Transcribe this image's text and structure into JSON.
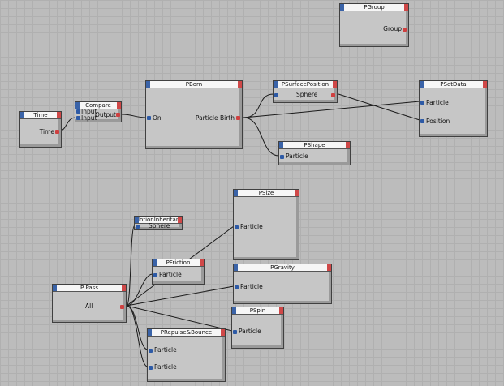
{
  "nodes": {
    "pgroup": {
      "title": "PGroup",
      "out": "Group"
    },
    "time": {
      "title": "Time",
      "out": "Time"
    },
    "compare": {
      "title": "Compare",
      "in1": "Input",
      "in2": "Input",
      "out": "Output"
    },
    "pborn": {
      "title": "PBorn",
      "in": "On",
      "out": "Particle Birth"
    },
    "psurfacepos": {
      "title": "PSurfacePosition",
      "in_label": "Sphere"
    },
    "psetdata": {
      "title": "PSetData",
      "in1": "Particle",
      "in2": "Position"
    },
    "pshape": {
      "title": "PShape",
      "in": "Particle"
    },
    "psize": {
      "title": "PSize",
      "in": "Particle"
    },
    "motion": {
      "title": "MotionInheritance",
      "in": "Sphere"
    },
    "pfriction": {
      "title": "PFriction",
      "in": "Particle"
    },
    "pgravity": {
      "title": "PGravity",
      "in": "Particle"
    },
    "ppass": {
      "title": "P Pass",
      "out": "All"
    },
    "pspin": {
      "title": "PSpin",
      "in": "Particle"
    },
    "prepulse": {
      "title": "PRepulse&Bounce",
      "in1": "Particle",
      "in2": "Particle"
    }
  },
  "colors": {
    "input_port": "#2d5aa6",
    "output_port": "#cf4040",
    "wire": "#1a1a1a",
    "canvas": "#bcbcbc"
  }
}
